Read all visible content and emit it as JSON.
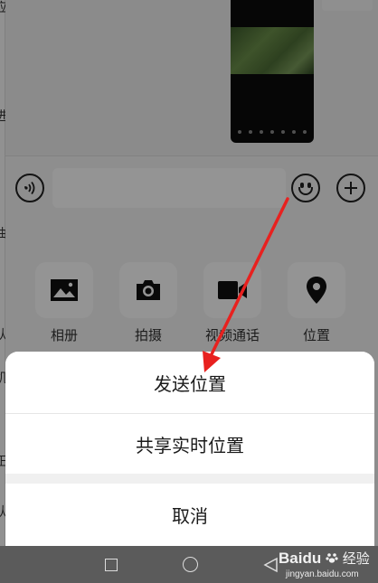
{
  "left_strip": {
    "chars": [
      "应",
      "进",
      "曲",
      "认",
      "机",
      "正",
      "认"
    ]
  },
  "input_bar": {
    "voice_icon": "voice-icon",
    "emoji_icon": "emoji-icon",
    "plus_icon": "plus-icon"
  },
  "tools": [
    {
      "label": "相册",
      "icon": "image-icon"
    },
    {
      "label": "拍摄",
      "icon": "camera-icon"
    },
    {
      "label": "视频通话",
      "icon": "video-camera-icon"
    },
    {
      "label": "位置",
      "icon": "location-pin-icon"
    }
  ],
  "action_sheet": {
    "send_location": "发送位置",
    "share_live_location": "共享实时位置",
    "cancel": "取消"
  },
  "watermark": {
    "logo": "Baidu",
    "logo_cn": "经验",
    "url": "jingyan.baidu.com"
  },
  "colors": {
    "annotation_arrow": "#e8211f",
    "nav_bar": "#5b5b5b"
  }
}
